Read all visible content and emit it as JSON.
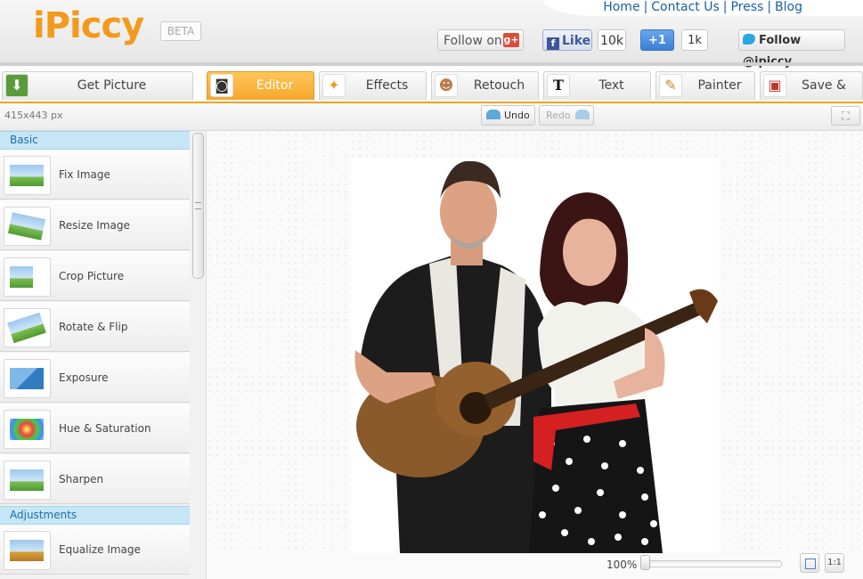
{
  "header": {
    "logo": "iPiccy",
    "badge": "BETA",
    "links": [
      "Home",
      "Contact Us",
      "Press",
      "Blog"
    ],
    "social": {
      "follow_on": "Follow on",
      "gplus_icon": "g+",
      "fb_like": "Like",
      "fb_icon": "f",
      "fb_count": "10k",
      "gplus_one": "+1",
      "gplus_count": "1k",
      "twitter_follow": "Follow @ipiccy"
    }
  },
  "tabs": [
    {
      "label": "Get Picture",
      "icon": "download-arrow-icon",
      "active": false
    },
    {
      "label": "Editor",
      "icon": "camera-icon",
      "active": true
    },
    {
      "label": "Effects",
      "icon": "magic-wand-icon",
      "active": false
    },
    {
      "label": "Retouch",
      "icon": "face-icon",
      "active": false
    },
    {
      "label": "Text",
      "icon": "text-t-icon",
      "active": false
    },
    {
      "label": "Painter",
      "icon": "palette-icon",
      "active": false
    },
    {
      "label": "Save & Share",
      "icon": "floppy-disk-icon",
      "active": false
    }
  ],
  "toolbar": {
    "dimensions": "415x443 px",
    "undo": "Undo",
    "redo": "Redo"
  },
  "sidebar": {
    "sections": [
      {
        "title": "Basic",
        "tools": [
          "Fix Image",
          "Resize Image",
          "Crop Picture",
          "Rotate & Flip",
          "Exposure",
          "Hue & Saturation",
          "Sharpen"
        ]
      },
      {
        "title": "Adjustments",
        "tools": [
          "Equalize Image"
        ]
      }
    ]
  },
  "zoom": {
    "label": "100%",
    "level": 1.0,
    "one_to_one": "1:1"
  },
  "colors": {
    "accent": "#f4a020",
    "link": "#1a5ea8",
    "section_bg": "#c6e6f6"
  }
}
